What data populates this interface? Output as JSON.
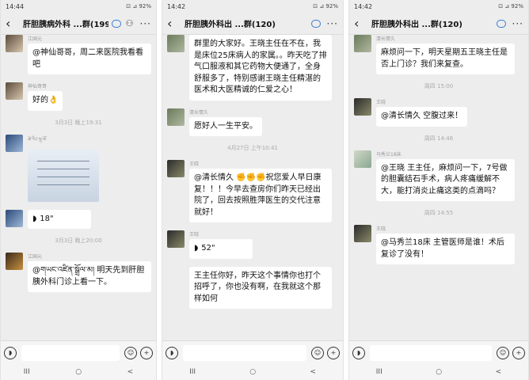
{
  "phones": [
    {
      "status": {
        "time": "14:44",
        "right": "⊡ ⊿ 92%"
      },
      "title": "肝胆胰病外科 ...群(199)",
      "messages": [
        {
          "sender": "江国元",
          "text": "@神仙哥哥，周二来医院我看看吧"
        },
        {
          "sender": "神仙哥哥",
          "text": "好的👌"
        },
        {
          "time": "3月3日 晚上19:31"
        },
        {
          "sender": "ཚེ་རིང་ལྷ་མོ",
          "image": true
        },
        {
          "sender": "ཚེ་རིང་ལྷ་མོ",
          "voice": "18\""
        },
        {
          "time": "3月3日 晚上20:00"
        },
        {
          "sender": "江国元",
          "text": "@གཡང་འཛིན་སྒྲོལ་མ། 明天先到肝胆胰外科门诊上看一下。"
        }
      ]
    },
    {
      "status": {
        "time": "14:42",
        "right": "⊡ ⊿ 92%"
      },
      "title": "肝胆胰外科出 ...群(120)",
      "messages": [
        {
          "text": "群里的大家好。王晓主任在不在，我是床位25床病人的家属。。昨天吃了排气口服液和其它药物大便通了，全身舒服多了，特别感谢王晓主任精湛的医术和大医精诚的仁爱之心！"
        },
        {
          "sender": "清长情久",
          "text": "愿好人一生平安。"
        },
        {
          "time": "4月27日 上午10:41"
        },
        {
          "sender": "王晓",
          "text": "@清长情久 ✊✊✊祝您爱人早日康复！！！今早去查房你们昨天已经出院了，回去按照胜萍医生的交代注意就好！"
        },
        {
          "sender": "王晓",
          "voice": "52\""
        },
        {
          "text": "王主任你好，昨天这个事情你也打个招呼了，你也没有啊，在我就这个那样如何"
        }
      ]
    },
    {
      "status": {
        "time": "14:42",
        "right": "⊡ ⊿ 92%"
      },
      "title": "肝胆胰外科出 ...群(120)",
      "messages": [
        {
          "sender": "清长情久",
          "text": "麻烦问一下，明天星期五王晓主任是否上门诊？我们来复查。"
        },
        {
          "time": "周四 15:00"
        },
        {
          "sender": "王晓",
          "text": "@清长情久 空腹过来！"
        },
        {
          "time": "周四 14:46"
        },
        {
          "sender": "马秀兰18床",
          "text": "@王晓 王主任，麻烦问一下，7号做的胆囊结石手术，病人疼痛缓解不大，能打消炎止痛这类的点滴吗？"
        },
        {
          "time": "周四 14:55"
        },
        {
          "sender": "王晓",
          "text": "@马秀兰18床 主管医师是谁！术后复诊了没有！"
        }
      ]
    }
  ],
  "nav": {
    "menu": "III",
    "home": "○",
    "back": "<"
  },
  "icons": {
    "voice": "voice-icon",
    "emoji": "emoji-icon",
    "plus": "plus-icon"
  }
}
